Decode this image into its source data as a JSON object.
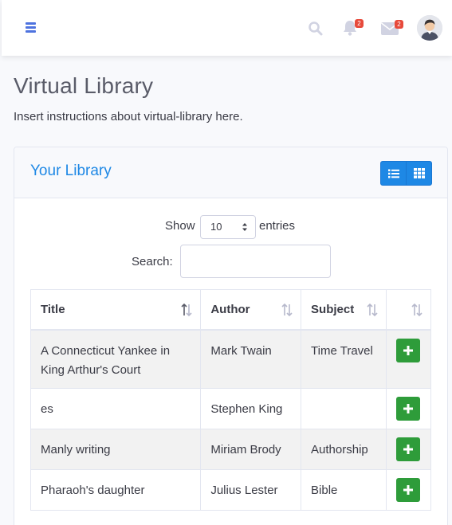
{
  "topbar": {
    "menu_icon": "bars-icon",
    "search_icon": "search-icon",
    "alerts_icon": "bell-icon",
    "alerts_count": "2",
    "messages_icon": "envelope-icon",
    "messages_count": "2",
    "avatar_icon": "user-avatar"
  },
  "page": {
    "title": "Virtual Library",
    "instructions": "Insert instructions about virtual-library here."
  },
  "card": {
    "title": "Your Library",
    "list_view_icon": "list-icon",
    "grid_view_icon": "grid-icon"
  },
  "table_controls": {
    "show_label": "Show",
    "page_length": "10",
    "entries_label": "entries",
    "search_label": "Search:",
    "search_value": ""
  },
  "table": {
    "columns": [
      "Title",
      "Author",
      "Subject",
      ""
    ],
    "rows": [
      {
        "title": "A Connecticut Yankee in King Arthur's Court",
        "author": "Mark Twain",
        "subject": "Time Travel"
      },
      {
        "title": "es",
        "author": "Stephen King",
        "subject": ""
      },
      {
        "title": "Manly writing",
        "author": "Miriam Brody",
        "subject": "Authorship"
      },
      {
        "title": "Pharaoh's daughter",
        "author": "Julius Lester",
        "subject": "Bible"
      }
    ],
    "add_icon": "plus-icon"
  },
  "colors": {
    "accent": "#1e88e5",
    "add_button": "#2e9c3a",
    "badge": "#e74a3b"
  }
}
